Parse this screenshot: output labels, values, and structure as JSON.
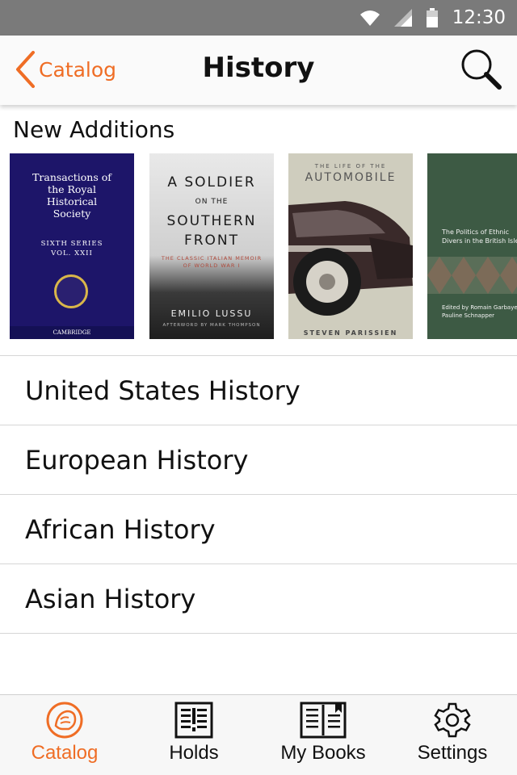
{
  "status_bar": {
    "time": "12:30",
    "icons": [
      "wifi-icon",
      "signal-icon",
      "battery-icon"
    ]
  },
  "header": {
    "back_label": "Catalog",
    "title": "History",
    "search_icon": "search-icon"
  },
  "accent_color": "#ef6d25",
  "new_additions": {
    "title": "New Additions",
    "books": [
      {
        "title": "Transactions of the Royal Historical Society",
        "series": "SIXTH SERIES",
        "volume": "VOL. XXII",
        "publisher": "CAMBRIDGE"
      },
      {
        "title_line1": "A SOLDIER",
        "title_line2": "ON THE",
        "title_line3": "SOUTHERN",
        "title_line4": "FRONT",
        "subtitle": "THE CLASSIC ITALIAN MEMOIR OF WORLD WAR I",
        "author": "EMILIO LUSSU",
        "afterword": "AFTERWORD BY MARK THOMPSON"
      },
      {
        "pre": "THE LIFE OF THE",
        "title": "AUTOMOBILE",
        "author": "STEVEN PARISSIEN"
      },
      {
        "title": "The Politics of Ethnic Divers in the British Isles",
        "editors": "Edited by Romain Garbaye and Pauline Schnapper"
      }
    ]
  },
  "categories": [
    {
      "label": "United States History"
    },
    {
      "label": "European History"
    },
    {
      "label": "African History"
    },
    {
      "label": "Asian History"
    }
  ],
  "tabs": [
    {
      "label": "Catalog",
      "icon": "lion-logo-icon",
      "active": true
    },
    {
      "label": "Holds",
      "icon": "holds-icon",
      "active": false
    },
    {
      "label": "My Books",
      "icon": "book-icon",
      "active": false
    },
    {
      "label": "Settings",
      "icon": "gear-icon",
      "active": false
    }
  ]
}
